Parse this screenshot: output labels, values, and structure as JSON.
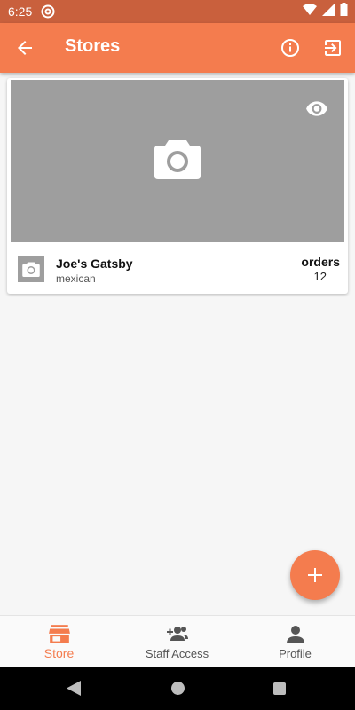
{
  "status_bar": {
    "time": "6:25",
    "icons": [
      "at-icon",
      "wifi-icon",
      "signal-icon",
      "battery-icon"
    ]
  },
  "app_bar": {
    "title": "Stores",
    "icons": [
      "back-arrow-icon",
      "info-icon",
      "logout-icon"
    ]
  },
  "stores": [
    {
      "name": "Joe's Gatsby",
      "cuisine": "mexican",
      "orders_label": "orders",
      "orders_count": "12"
    }
  ],
  "bottom_nav": {
    "items": [
      {
        "label": "Store",
        "icon": "store-icon",
        "active": true
      },
      {
        "label": "Staff Access",
        "icon": "add-people-icon",
        "active": false
      },
      {
        "label": "Profile",
        "icon": "person-icon",
        "active": false
      }
    ]
  },
  "colors": {
    "accent": "#f47c4e",
    "status_bar": "#c9603d",
    "placeholder": "#9e9e9e"
  }
}
